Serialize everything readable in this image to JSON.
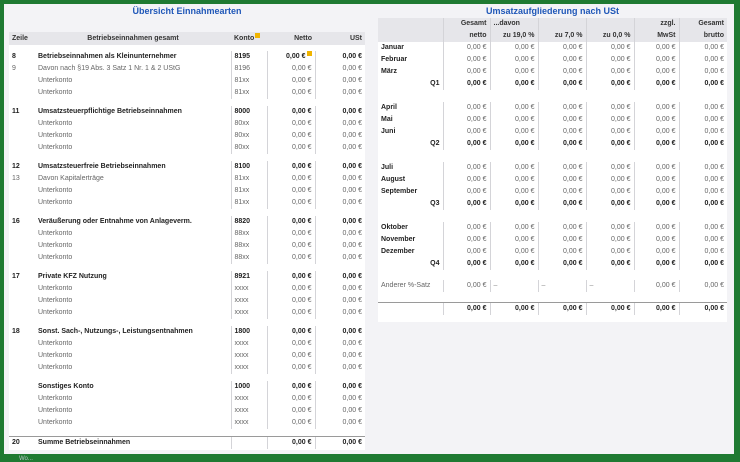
{
  "left": {
    "title": "Übersicht Einnahmearten",
    "headers": {
      "row": "Zeile",
      "name": "Betriebseinnahmen gesamt",
      "konto": "Konto",
      "netto": "Netto",
      "ust": "USt"
    },
    "blocks": [
      {
        "rows": [
          {
            "nr": "8",
            "name": "Betriebseinnahmen als Kleinunternehmer",
            "konto": "8195",
            "netto": "0,00 €",
            "ust": "0,00 €",
            "bold": true
          },
          {
            "nr": "9",
            "name": "Davon nach §19 Abs. 3 Satz 1 Nr. 1 & 2 UStG",
            "konto": "8196",
            "netto": "0,00 €",
            "ust": "0,00 €"
          },
          {
            "nr": "",
            "name": "Unterkonto",
            "konto": "81xx",
            "netto": "0,00 €",
            "ust": "0,00 €"
          },
          {
            "nr": "",
            "name": "Unterkonto",
            "konto": "81xx",
            "netto": "0,00 €",
            "ust": "0,00 €"
          }
        ]
      },
      {
        "rows": [
          {
            "nr": "11",
            "name": "Umsatzsteuerpflichtige Betriebseinnahmen",
            "konto": "8000",
            "netto": "0,00 €",
            "ust": "0,00 €",
            "bold": true
          },
          {
            "nr": "",
            "name": "Unterkonto",
            "konto": "80xx",
            "netto": "0,00 €",
            "ust": "0,00 €"
          },
          {
            "nr": "",
            "name": "Unterkonto",
            "konto": "80xx",
            "netto": "0,00 €",
            "ust": "0,00 €"
          },
          {
            "nr": "",
            "name": "Unterkonto",
            "konto": "80xx",
            "netto": "0,00 €",
            "ust": "0,00 €"
          }
        ]
      },
      {
        "rows": [
          {
            "nr": "12",
            "name": "Umsatzsteuerfreie Betriebseinnahmen",
            "konto": "8100",
            "netto": "0,00 €",
            "ust": "0,00 €",
            "bold": true
          },
          {
            "nr": "13",
            "name": "Davon Kapitalerträge",
            "konto": "81xx",
            "netto": "0,00 €",
            "ust": "0,00 €"
          },
          {
            "nr": "",
            "name": "Unterkonto",
            "konto": "81xx",
            "netto": "0,00 €",
            "ust": "0,00 €"
          },
          {
            "nr": "",
            "name": "Unterkonto",
            "konto": "81xx",
            "netto": "0,00 €",
            "ust": "0,00 €"
          }
        ]
      },
      {
        "rows": [
          {
            "nr": "16",
            "name": "Veräußerung oder Entnahme von Anlageverm.",
            "konto": "8820",
            "netto": "0,00 €",
            "ust": "0,00 €",
            "bold": true
          },
          {
            "nr": "",
            "name": "Unterkonto",
            "konto": "88xx",
            "netto": "0,00 €",
            "ust": "0,00 €"
          },
          {
            "nr": "",
            "name": "Unterkonto",
            "konto": "88xx",
            "netto": "0,00 €",
            "ust": "0,00 €"
          },
          {
            "nr": "",
            "name": "Unterkonto",
            "konto": "88xx",
            "netto": "0,00 €",
            "ust": "0,00 €"
          }
        ]
      },
      {
        "rows": [
          {
            "nr": "17",
            "name": "Private KFZ Nutzung",
            "konto": "8921",
            "netto": "0,00 €",
            "ust": "0,00 €",
            "bold": true
          },
          {
            "nr": "",
            "name": "Unterkonto",
            "konto": "xxxx",
            "netto": "0,00 €",
            "ust": "0,00 €"
          },
          {
            "nr": "",
            "name": "Unterkonto",
            "konto": "xxxx",
            "netto": "0,00 €",
            "ust": "0,00 €"
          },
          {
            "nr": "",
            "name": "Unterkonto",
            "konto": "xxxx",
            "netto": "0,00 €",
            "ust": "0,00 €"
          }
        ]
      },
      {
        "rows": [
          {
            "nr": "18",
            "name": "Sonst. Sach-, Nutzungs-, Leistungsentnahmen",
            "konto": "1800",
            "netto": "0,00 €",
            "ust": "0,00 €",
            "bold": true
          },
          {
            "nr": "",
            "name": "Unterkonto",
            "konto": "xxxx",
            "netto": "0,00 €",
            "ust": "0,00 €"
          },
          {
            "nr": "",
            "name": "Unterkonto",
            "konto": "xxxx",
            "netto": "0,00 €",
            "ust": "0,00 €"
          },
          {
            "nr": "",
            "name": "Unterkonto",
            "konto": "xxxx",
            "netto": "0,00 €",
            "ust": "0,00 €"
          }
        ]
      },
      {
        "rows": [
          {
            "nr": "",
            "name": "Sonstiges Konto",
            "konto": "1000",
            "netto": "0,00 €",
            "ust": "0,00 €",
            "bold": true
          },
          {
            "nr": "",
            "name": "Unterkonto",
            "konto": "xxxx",
            "netto": "0,00 €",
            "ust": "0,00 €"
          },
          {
            "nr": "",
            "name": "Unterkonto",
            "konto": "xxxx",
            "netto": "0,00 €",
            "ust": "0,00 €"
          },
          {
            "nr": "",
            "name": "Unterkonto",
            "konto": "xxxx",
            "netto": "0,00 €",
            "ust": "0,00 €"
          }
        ]
      }
    ],
    "total": {
      "nr": "20",
      "name": "Summe Betriebseinnahmen",
      "netto": "0,00 €",
      "ust": "0,00 €"
    },
    "watermark": "Wo..."
  },
  "right": {
    "title": "Umsatzaufgliederung nach USt",
    "header1": [
      "Gesamt",
      "...davon",
      "",
      "",
      "zzgl.",
      "Gesamt"
    ],
    "header2": [
      "netto",
      "zu 19,0 %",
      "zu 7,0 %",
      "zu 0,0 %",
      "MwSt",
      "brutto"
    ],
    "quarters": [
      {
        "months": [
          "Januar",
          "Februar",
          "März"
        ],
        "label": "Q1"
      },
      {
        "months": [
          "April",
          "Mai",
          "Juni"
        ],
        "label": "Q2"
      },
      {
        "months": [
          "Juli",
          "August",
          "September"
        ],
        "label": "Q3"
      },
      {
        "months": [
          "Oktober",
          "November",
          "Dezember"
        ],
        "label": "Q4"
      }
    ],
    "zero": "0,00 €",
    "other": {
      "label": "Anderer %-Satz",
      "values": [
        "0,00 €",
        "–",
        "–",
        "–",
        "0,00 €",
        "0,00 €"
      ]
    },
    "total": [
      "0,00 €",
      "0,00 €",
      "0,00 €",
      "0,00 €",
      "0,00 €",
      "0,00 €"
    ]
  }
}
